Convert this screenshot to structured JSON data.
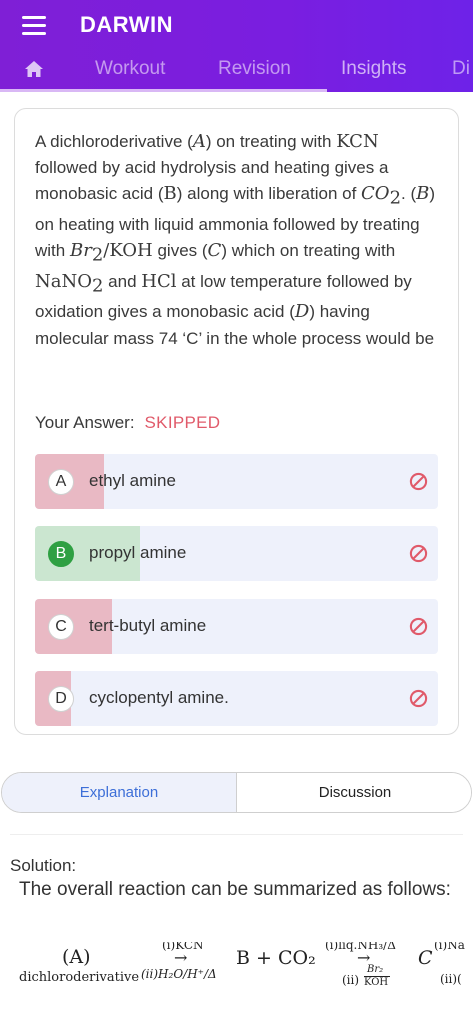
{
  "app": {
    "title": "DARWIN"
  },
  "tabs": [
    {
      "label": "Workout"
    },
    {
      "label": "Revision"
    },
    {
      "label": "Insights"
    },
    {
      "label": "Di"
    }
  ],
  "question": {
    "parts": [
      "A dichloroderivative (",
      "A",
      ") on treating with ",
      "KCN",
      " followed by acid hydrolysis and heating gives a monobasic acid (",
      "B",
      ") along with liberation of ",
      "CO",
      "2",
      ". (",
      "B",
      ") on heating with liquid ammonia followed by treating with ",
      "Br",
      "2",
      "/KOH",
      " gives (",
      "C",
      ") which on treating with ",
      "NaNO",
      "2",
      " and ",
      "HCl",
      " at low temperature followed by oxidation gives a monobasic acid (",
      "D",
      ") having molecular mass 74 ‘C’ in the whole process would be"
    ]
  },
  "your_answer": {
    "label": "Your Answer:",
    "value": "SKIPPED"
  },
  "options": [
    {
      "letter": "A",
      "text": "ethyl amine",
      "fill": 0.17,
      "fill_color": "#e9b9c4",
      "correct": false
    },
    {
      "letter": "B",
      "text": "propyl amine",
      "fill": 0.26,
      "fill_color": "#cbe6d0",
      "correct": true
    },
    {
      "letter": "C",
      "text": "tert-butyl amine",
      "fill": 0.19,
      "fill_color": "#e9b9c4",
      "correct": false
    },
    {
      "letter": "D",
      "text": "cyclopentyl amine.",
      "fill": 0.09,
      "fill_color": "#e9b9c4",
      "correct": false
    }
  ],
  "segments": {
    "left": "Explanation",
    "right": "Discussion"
  },
  "solution": {
    "label": "Solution:",
    "intro": "The overall reaction can be summarized as follows:",
    "equation": {
      "a": "(A)",
      "a_sub": "dichloroderivative",
      "arrow1_top": "(i)KCN",
      "arrow1_bottom": "(ii)H₂O/H⁺/Δ",
      "product": "B + CO₂",
      "arrow2_top": "(i)liq.NH₃/Δ",
      "arrow2_bottom_pre": "(ii)",
      "arrow2_bottom_num": "Br₂",
      "arrow2_bottom_den": "KOH",
      "c": "C",
      "c_top": "(i)Na",
      "c_bottom": "(ii)("
    }
  },
  "colors": {
    "header": "#7a1ee0",
    "accent_red": "#e05a6a",
    "correct_green": "#2fa043",
    "option_bg": "#eef1fb",
    "link_blue": "#3d6fd8"
  }
}
